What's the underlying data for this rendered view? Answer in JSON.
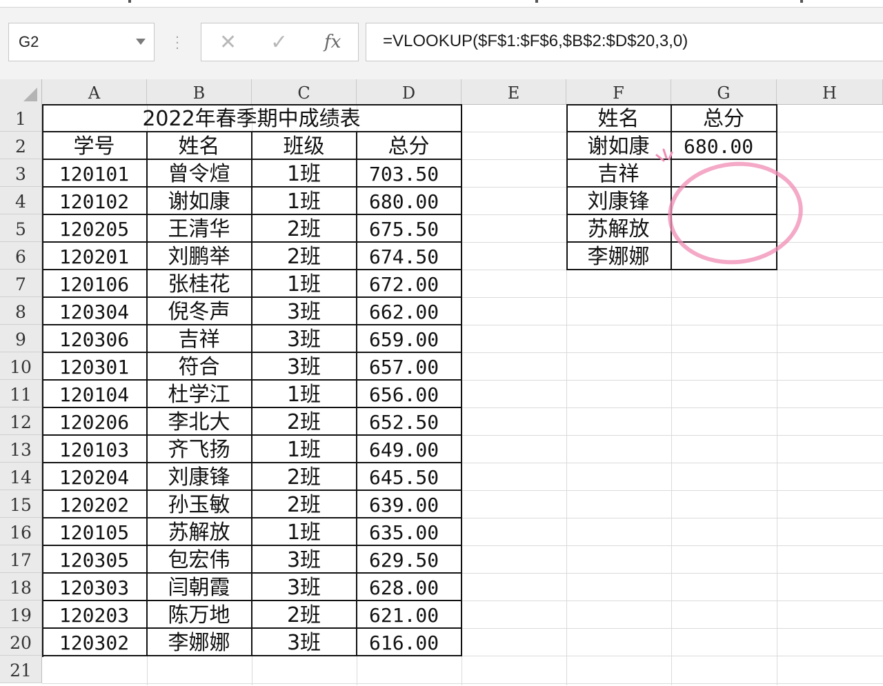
{
  "formula_bar": {
    "name_box": "G2",
    "cancel_icon": "✕",
    "enter_icon": "✓",
    "fx_icon": "fx",
    "formula": "=VLOOKUP($F$1:$F$6,$B$2:$D$20,3,0)"
  },
  "columns": [
    "A",
    "B",
    "C",
    "D",
    "E",
    "F",
    "G",
    "H"
  ],
  "rows": [
    "1",
    "2",
    "3",
    "4",
    "5",
    "6",
    "7",
    "8",
    "9",
    "10",
    "11",
    "12",
    "13",
    "14",
    "15",
    "16",
    "17",
    "18",
    "19",
    "20",
    "21"
  ],
  "table": {
    "title": "2022年春季期中成绩表",
    "headers": [
      "学号",
      "姓名",
      "班级",
      "总分"
    ],
    "rows": [
      [
        "120101",
        "曾令煊",
        "1班",
        "703.50"
      ],
      [
        "120102",
        "谢如康",
        "1班",
        "680.00"
      ],
      [
        "120205",
        "王清华",
        "2班",
        "675.50"
      ],
      [
        "120201",
        "刘鹏举",
        "2班",
        "674.50"
      ],
      [
        "120106",
        "张桂花",
        "1班",
        "672.00"
      ],
      [
        "120304",
        "倪冬声",
        "3班",
        "662.00"
      ],
      [
        "120306",
        "吉祥",
        "3班",
        "659.00"
      ],
      [
        "120301",
        "符合",
        "3班",
        "657.00"
      ],
      [
        "120104",
        "杜学江",
        "1班",
        "656.00"
      ],
      [
        "120206",
        "李北大",
        "2班",
        "652.50"
      ],
      [
        "120103",
        "齐飞扬",
        "1班",
        "649.00"
      ],
      [
        "120204",
        "刘康锋",
        "2班",
        "645.50"
      ],
      [
        "120202",
        "孙玉敏",
        "2班",
        "639.00"
      ],
      [
        "120105",
        "苏解放",
        "1班",
        "635.00"
      ],
      [
        "120305",
        "包宏伟",
        "3班",
        "629.50"
      ],
      [
        "120303",
        "闫朝霞",
        "3班",
        "628.00"
      ],
      [
        "120203",
        "陈万地",
        "2班",
        "621.00"
      ],
      [
        "120302",
        "李娜娜",
        "3班",
        "616.00"
      ]
    ]
  },
  "lookup": {
    "headers": [
      "姓名",
      "总分"
    ],
    "rows": [
      [
        "谢如康",
        "680.00"
      ],
      [
        "吉祥",
        ""
      ],
      [
        "刘康锋",
        ""
      ],
      [
        "苏解放",
        ""
      ],
      [
        "李娜娜",
        ""
      ]
    ]
  },
  "colors": {
    "highlight": "#f08cb4",
    "border": "#111111",
    "header_bg": "#eaeaea"
  }
}
